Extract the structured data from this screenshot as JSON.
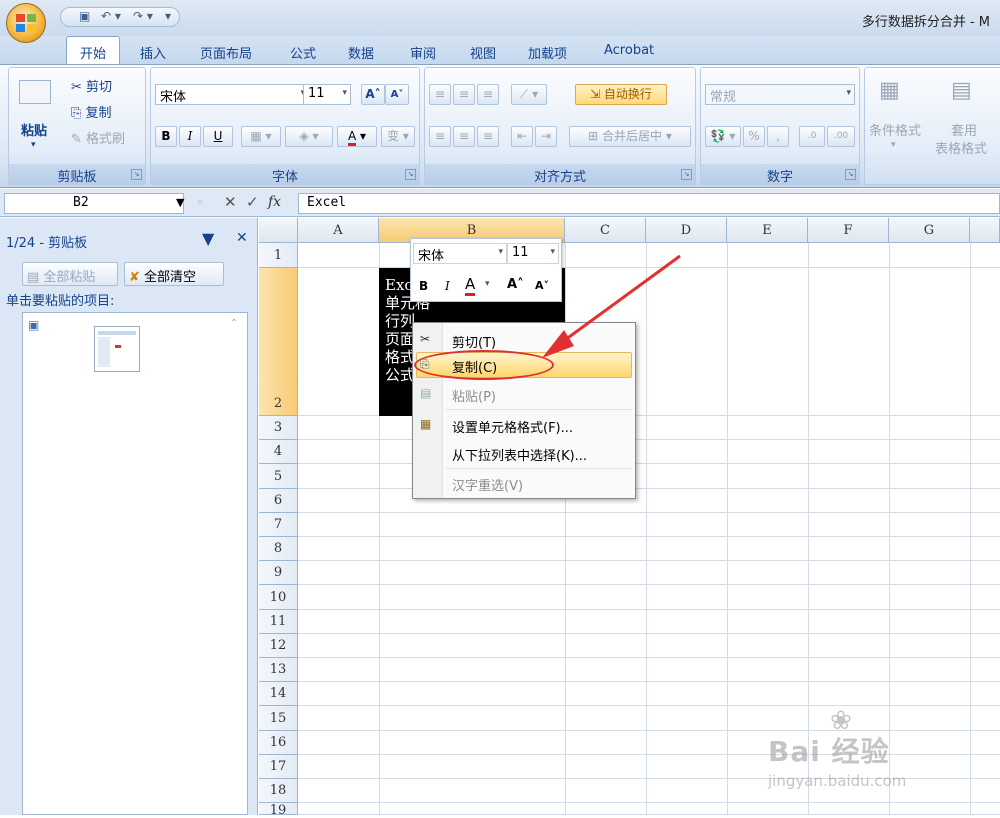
{
  "window": {
    "title": "多行数据拆分合并 - M"
  },
  "tabs": [
    "开始",
    "插入",
    "页面布局",
    "公式",
    "数据",
    "审阅",
    "视图",
    "加载项",
    "Acrobat"
  ],
  "ribbon": {
    "clipboard": {
      "label": "剪贴板",
      "paste": "粘贴",
      "cut": "剪切",
      "copy": "复制",
      "format_painter": "格式刷"
    },
    "font": {
      "label": "字体",
      "name": "宋体",
      "size": "11",
      "bold": "B",
      "italic": "I",
      "underline": "U",
      "grow": "A",
      "shrink": "A",
      "color_a": "A",
      "phonetic": "变"
    },
    "alignment": {
      "label": "对齐方式",
      "wrap": "自动换行",
      "merge": "合并后居中"
    },
    "number": {
      "label": "数字",
      "format": "常规",
      "percent": "%",
      "comma": ",",
      "inc": ".0",
      "dec": ".00"
    },
    "styles": {
      "conditional": "条件格式",
      "table_line1": "套用",
      "table_line2": "表格格式"
    }
  },
  "formula_bar": {
    "name_box": "B2",
    "fx": "fx",
    "formula": "Excel"
  },
  "clipboard_pane": {
    "title": "1/24 - 剪贴板",
    "paste_all": "全部粘贴",
    "clear_all": "全部清空",
    "hint": "单击要粘贴的项目:"
  },
  "sheet": {
    "columns": [
      "A",
      "B",
      "C",
      "D",
      "E",
      "F",
      "G"
    ],
    "rows": [
      "1",
      "2",
      "3",
      "4",
      "5",
      "6",
      "7",
      "8",
      "9",
      "10",
      "11",
      "12",
      "13",
      "14",
      "15",
      "16",
      "17",
      "18",
      "19"
    ],
    "selected_cell": "B2",
    "b2_lines": [
      "Exc",
      "单元格",
      "行列",
      "页面",
      "格式",
      "公式"
    ]
  },
  "mini_toolbar": {
    "font": "宋体",
    "size": "11",
    "bold": "B",
    "italic": "I",
    "color": "A",
    "grow": "A",
    "shrink": "A"
  },
  "context_menu": {
    "items": [
      {
        "label": "剪切(T)",
        "enabled": true
      },
      {
        "label": "复制(C)",
        "enabled": true,
        "highlighted": true
      },
      {
        "label": "粘贴(P)",
        "enabled": false
      },
      {
        "label": "设置单元格格式(F)...",
        "enabled": true
      },
      {
        "label": "从下拉列表中选择(K)...",
        "enabled": true
      },
      {
        "label": "汉字重选(V)",
        "enabled": false
      }
    ]
  },
  "watermark": {
    "brand": "Bai 经验",
    "url": "jingyan.baidu.com"
  },
  "colors": {
    "accent_red": "#e03030",
    "highlight": "#ffd66e",
    "selected_header": "#f8ca74"
  }
}
